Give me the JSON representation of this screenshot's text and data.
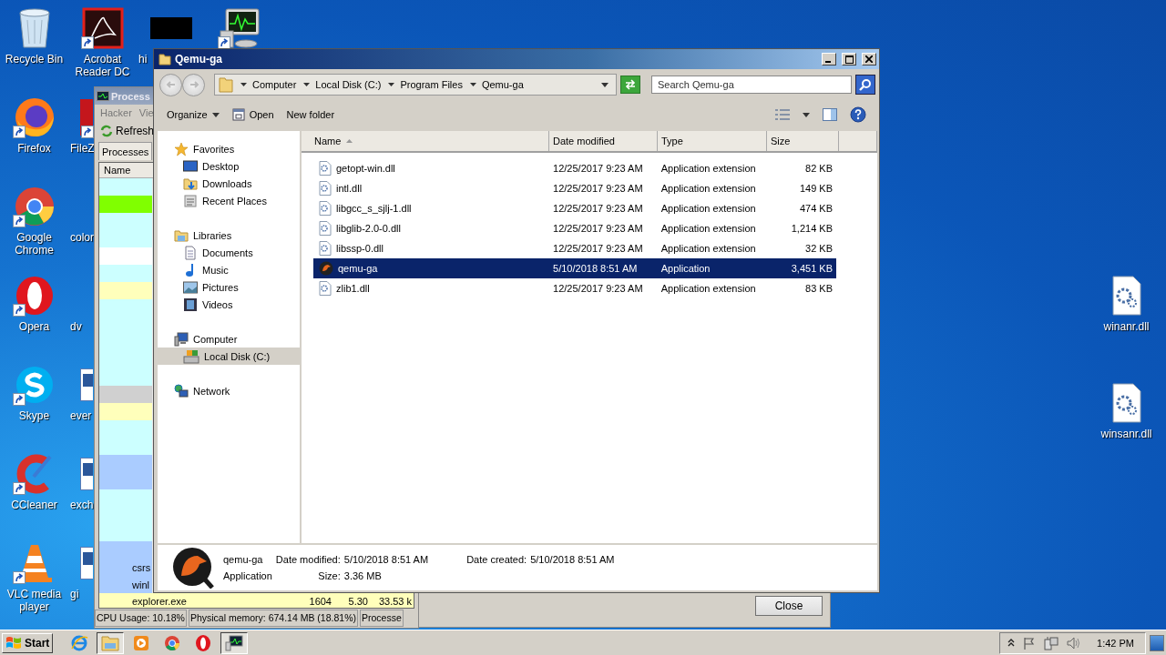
{
  "desktop": {
    "icon_columns": [
      [
        {
          "kind": "recycle",
          "label": "Recycle Bin",
          "shortcut": false
        },
        {
          "kind": "firefox",
          "label": "Firefox",
          "shortcut": true
        },
        {
          "kind": "chrome",
          "label": "Google Chrome",
          "shortcut": true
        },
        {
          "kind": "opera",
          "label": "Opera",
          "shortcut": true
        },
        {
          "kind": "skype",
          "label": "Skype",
          "shortcut": true
        },
        {
          "kind": "ccleaner",
          "label": "CCleaner",
          "shortcut": true
        },
        {
          "kind": "vlc",
          "label": "VLC media player",
          "shortcut": true
        }
      ],
      [
        {
          "kind": "acrobat",
          "label": "Acrobat Reader DC",
          "shortcut": true
        },
        {
          "kind": "app",
          "label": "FileZ",
          "shortcut": true
        },
        {
          "kind": "blank",
          "label": "color",
          "shortcut": false
        },
        {
          "kind": "blank",
          "label": "dv",
          "shortcut": false
        },
        {
          "kind": "document",
          "label": "ever",
          "shortcut": false
        },
        {
          "kind": "document",
          "label": "exch",
          "shortcut": false
        },
        {
          "kind": "document",
          "label": "gi",
          "shortcut": false
        }
      ],
      [
        {
          "kind": "tile",
          "label": "hi",
          "shortcut": false
        }
      ],
      [
        {
          "kind": "monitor",
          "shortcut": true
        }
      ]
    ],
    "right_icons": [
      {
        "kind": "dll",
        "label": "winanr.dll",
        "shortcut": false
      },
      {
        "kind": "dll",
        "label": "winsanr.dll",
        "shortcut": false
      }
    ]
  },
  "process_hacker": {
    "title": "Process",
    "menu": [
      "Hacker",
      "Vie"
    ],
    "toolbar": {
      "refresh": "Refresh"
    },
    "tab": "Processes",
    "column": "Name",
    "rows": [
      {
        "color": "#ccffff"
      },
      {
        "color": "#80ff00"
      },
      {
        "color": "#ccffff"
      },
      {
        "color": "#ccffff"
      },
      {
        "color": "#ffffff"
      },
      {
        "color": "#ccffff"
      },
      {
        "color": "#ffffbb"
      },
      {
        "color": "#ccffff"
      },
      {
        "color": "#ccffff"
      },
      {
        "color": "#ccffff"
      },
      {
        "color": "#ccffff"
      },
      {
        "color": "#ccffff"
      },
      {
        "color": "#d0d0d0"
      },
      {
        "color": "#ffffbb"
      },
      {
        "color": "#ccffff"
      },
      {
        "color": "#ccffff"
      },
      {
        "color": "#aaccff"
      },
      {
        "color": "#aaccff"
      },
      {
        "color": "#ccffff"
      },
      {
        "color": "#ccffff"
      },
      {
        "color": "#ccffff"
      },
      {
        "color": "#aaccff"
      },
      {
        "color": "#aaccff",
        "name": "csrs"
      },
      {
        "color": "#aaccff",
        "name": "winl"
      },
      {
        "color": "#ffffbb",
        "name": "explorer.exe",
        "pid": "1604",
        "cpu": "5.30",
        "memory": "33.53 k"
      }
    ],
    "status_bar": [
      "CPU Usage: 10.18%",
      "Physical memory: 674.14 MB (18.81%)",
      "Processe"
    ]
  },
  "dialog": {
    "button": "Close"
  },
  "explorer": {
    "title": "Qemu-ga",
    "breadcrumb": [
      "Computer",
      "Local Disk (C:)",
      "Program Files",
      "Qemu-ga"
    ],
    "search": {
      "placeholder": "Search Qemu-ga"
    },
    "toolbar": [
      "Organize",
      "Open",
      "New folder"
    ],
    "nav": [
      {
        "label": "Favorites",
        "kind": "star",
        "children": [
          {
            "label": "Desktop",
            "kind": "desktop",
            "selected": false
          },
          {
            "label": "Downloads",
            "kind": "downloads",
            "selected": false
          },
          {
            "label": "Recent Places",
            "kind": "recent",
            "selected": false
          }
        ]
      },
      {
        "label": "Libraries",
        "kind": "library",
        "children": [
          {
            "label": "Documents",
            "kind": "documents",
            "selected": false
          },
          {
            "label": "Music",
            "kind": "music",
            "selected": false
          },
          {
            "label": "Pictures",
            "kind": "pictures",
            "selected": false
          },
          {
            "label": "Videos",
            "kind": "videos",
            "selected": false
          }
        ]
      },
      {
        "label": "Computer",
        "kind": "computer",
        "children": [
          {
            "label": "Local Disk (C:)",
            "kind": "disk",
            "selected": true
          }
        ]
      },
      {
        "label": "Network",
        "kind": "network"
      }
    ],
    "columns": [
      "Name",
      "Date modified",
      "Type",
      "Size"
    ],
    "files": [
      {
        "kind": "dll",
        "name": "getopt-win.dll",
        "modified": "12/25/2017 9:23 AM",
        "type": "Application extension",
        "size": "82 KB",
        "selected": false
      },
      {
        "kind": "dll",
        "name": "intl.dll",
        "modified": "12/25/2017 9:23 AM",
        "type": "Application extension",
        "size": "149 KB",
        "selected": false
      },
      {
        "kind": "dll",
        "name": "libgcc_s_sjlj-1.dll",
        "modified": "12/25/2017 9:23 AM",
        "type": "Application extension",
        "size": "474 KB",
        "selected": false
      },
      {
        "kind": "dll",
        "name": "libglib-2.0-0.dll",
        "modified": "12/25/2017 9:23 AM",
        "type": "Application extension",
        "size": "1,214 KB",
        "selected": false
      },
      {
        "kind": "dll",
        "name": "libssp-0.dll",
        "modified": "12/25/2017 9:23 AM",
        "type": "Application extension",
        "size": "32 KB",
        "selected": false
      },
      {
        "kind": "app",
        "name": "qemu-ga",
        "modified": "5/10/2018 8:51 AM",
        "type": "Application",
        "size": "3,451 KB",
        "selected": true
      },
      {
        "kind": "dll",
        "name": "zlib1.dll",
        "modified": "12/25/2017 9:23 AM",
        "type": "Application extension",
        "size": "83 KB",
        "selected": false
      }
    ],
    "details": {
      "name": "qemu-ga",
      "type": "Application",
      "properties": [
        {
          "label": "Date modified:",
          "value": "5/10/2018 8:51 AM"
        },
        {
          "label": "Size:",
          "value": "3.36 MB"
        },
        {
          "label": "Date created:",
          "value": "5/10/2018 8:51 AM"
        }
      ]
    }
  },
  "taskbar": {
    "start": "Start",
    "apps": [
      {
        "kind": "ie",
        "running": false
      },
      {
        "kind": "folder",
        "running": true
      },
      {
        "kind": "media",
        "running": false
      },
      {
        "kind": "chrome",
        "running": false
      },
      {
        "kind": "opera",
        "running": false
      },
      {
        "kind": "monitor",
        "running": true
      }
    ],
    "clock": "1:42 PM"
  }
}
